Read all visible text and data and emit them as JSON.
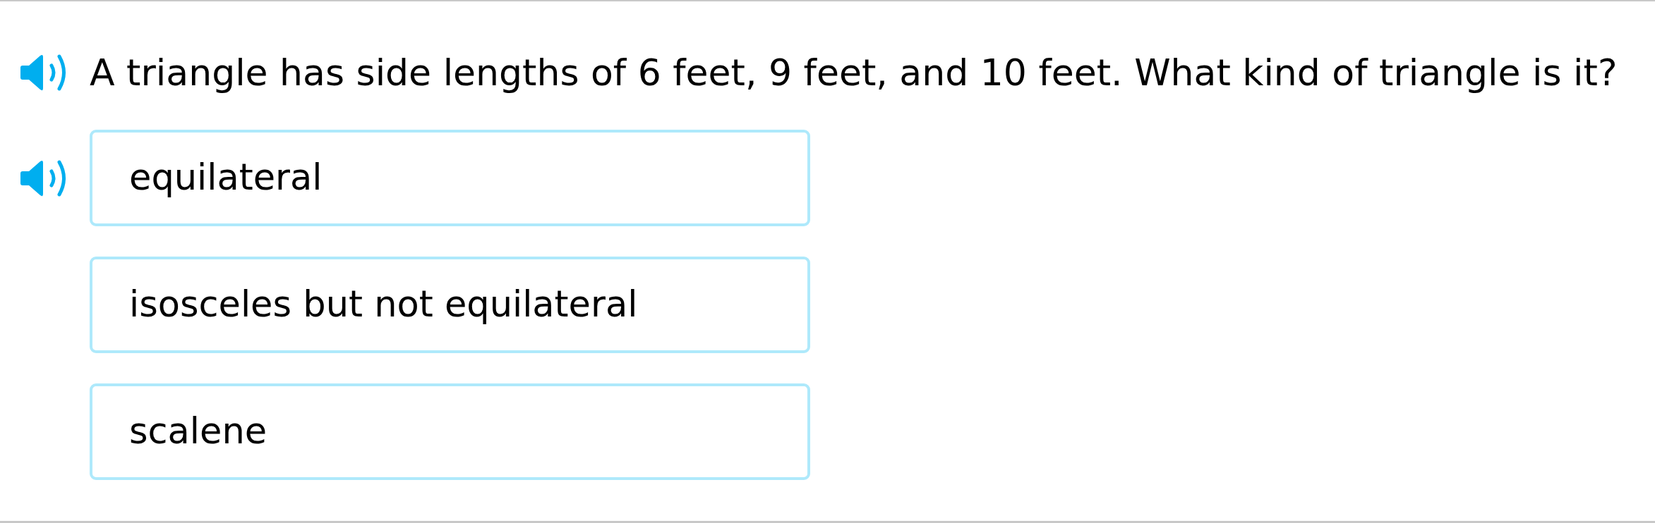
{
  "question": {
    "text": "A triangle has side lengths of 6 feet, 9 feet, and 10 feet. What kind of triangle is it?",
    "speaker": true
  },
  "options": [
    {
      "text": "equilateral",
      "speaker": true
    },
    {
      "text": "isosceles but not equilateral",
      "speaker": false
    },
    {
      "text": "scalene",
      "speaker": false
    }
  ]
}
